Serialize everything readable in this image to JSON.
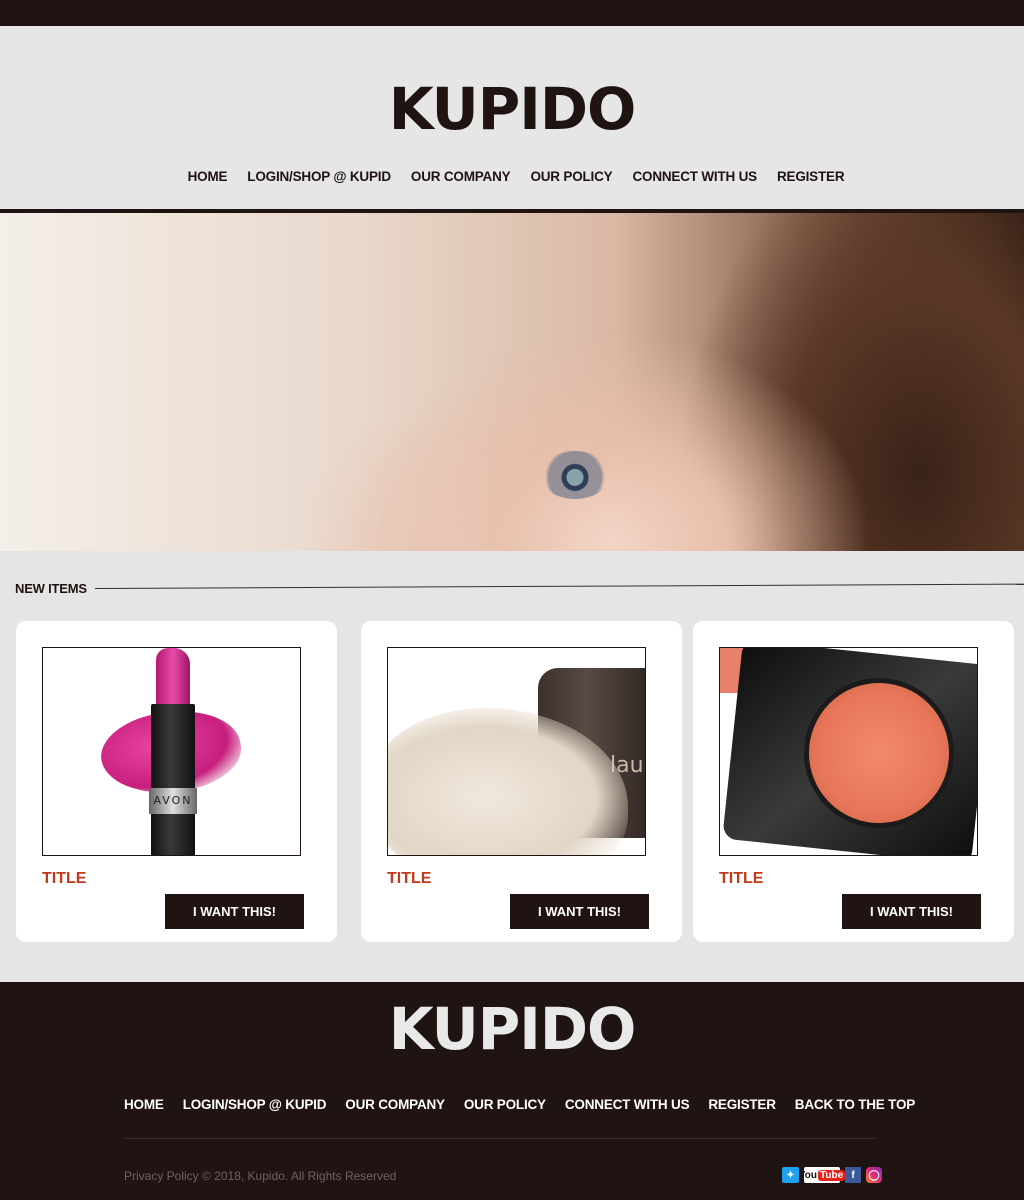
{
  "brand": {
    "logo": "KUPIDO"
  },
  "nav": [
    "HOME",
    "LOGIN/SHOP @ KUPID",
    "OUR COMPANY",
    "OUR POLICY",
    "CONNECT WITH US",
    "REGISTER"
  ],
  "section": {
    "title": "NEW ITEMS"
  },
  "products": [
    {
      "title": "TITLE",
      "button": "I WANT THIS!",
      "brand_text": "AVON"
    },
    {
      "title": "TITLE",
      "button": "I WANT THIS!",
      "brand_text": "lau"
    },
    {
      "title": "TITLE",
      "button": "I WANT THIS!"
    }
  ],
  "footer": {
    "logo": "KUPIDO",
    "nav": [
      "HOME",
      "LOGIN/SHOP @ KUPID",
      "OUR COMPANY",
      "OUR POLICY",
      "CONNECT WITH US",
      "REGISTER",
      "BACK TO THE TOP"
    ],
    "copyright": "Privacy Policy © 2018, Kupido. All Rights Reserved",
    "social": [
      "twitter-icon",
      "youtube-icon",
      "facebook-icon",
      "instagram-icon"
    ],
    "youtube_label": "You",
    "youtube_label_tube": "Tube"
  },
  "colors": {
    "dark": "#1f1412",
    "accent": "#c2391b",
    "background": "#e5e5e5"
  }
}
